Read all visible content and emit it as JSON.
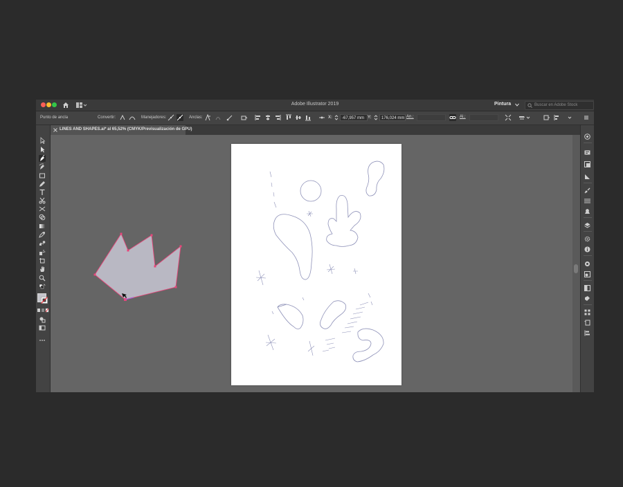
{
  "app": {
    "title": "Adobe Illustrator 2019",
    "workspace": "Pintura",
    "stock_search_placeholder": "Buscar en Adobe Stock"
  },
  "control_bar": {
    "selection_label": "Punto de ancla",
    "convert_label": "Convertir:",
    "handles_label": "Manejadores:",
    "anchors_label": "Anclas:",
    "x_label": "X:",
    "x_value": "-67,957 mm",
    "y_label": "Y:",
    "y_value": "176,024 mm",
    "w_label": "An.:",
    "h_label": "Al.:"
  },
  "document_tab": {
    "title": "LINES AND SHAPES.ai* al 65,52% (CMYK/Previsualización de GPU)"
  },
  "tools": [
    {
      "name": "selection-tool-icon"
    },
    {
      "name": "direct-selection-tool-icon"
    },
    {
      "name": "pen-tool-icon",
      "selected": true
    },
    {
      "name": "curvature-tool-icon"
    },
    {
      "name": "rectangle-tool-icon"
    },
    {
      "name": "pencil-tool-icon"
    },
    {
      "name": "type-tool-icon"
    },
    {
      "name": "scissors-tool-icon"
    },
    {
      "name": "width-tool-icon"
    },
    {
      "name": "shape-builder-tool-icon"
    },
    {
      "name": "gradient-tool-icon"
    },
    {
      "name": "eyedropper-tool-icon"
    },
    {
      "name": "blend-tool-icon"
    },
    {
      "name": "symbol-sprayer-tool-icon"
    },
    {
      "name": "artboard-tool-icon"
    },
    {
      "name": "hand-tool-icon"
    },
    {
      "name": "zoom-tool-icon"
    }
  ],
  "colors": {
    "fill_swatch": "#c5c5cc",
    "crown_fill": "#b9b8c3",
    "crown_stroke": "#e8457a",
    "line_art": "#8e91b8"
  }
}
